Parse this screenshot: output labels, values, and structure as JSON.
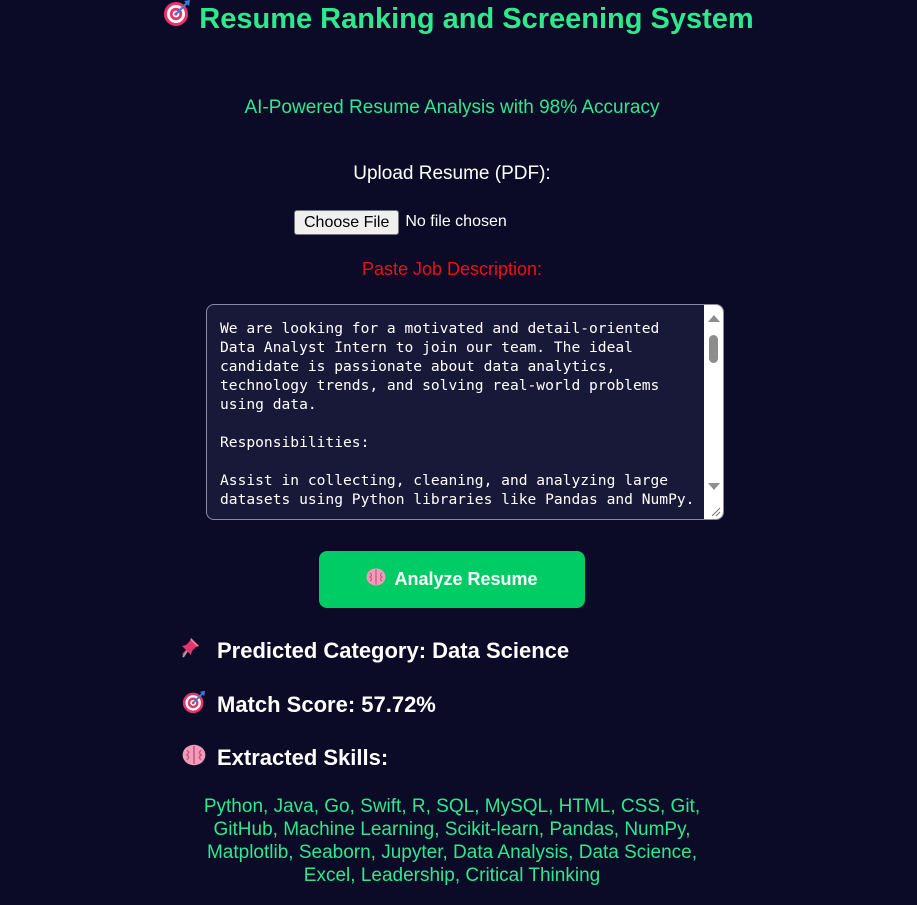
{
  "header": {
    "title": "Resume Ranking and Screening System",
    "title_icon": "direct-hit-target-icon",
    "subtitle": "AI-Powered Resume Analysis with 98% Accuracy"
  },
  "upload": {
    "label": "Upload Resume (PDF):",
    "button_label": "Choose File",
    "status": "No file chosen"
  },
  "job_description": {
    "label": "Paste Job Description:",
    "text": "We are looking for a motivated and detail-oriented Data Analyst Intern to join our team. The ideal candidate is passionate about data analytics, technology trends, and solving real-world problems using data.\n\nResponsibilities:\n\nAssist in collecting, cleaning, and analyzing large datasets using Python libraries like Pandas and NumPy."
  },
  "analyze_button": {
    "label": "Analyze Resume",
    "icon": "brain-icon"
  },
  "results": {
    "category": "Predicted Category: Data Science",
    "category_icon": "pushpin-icon",
    "match_score": "Match Score: 57.72%",
    "match_icon": "direct-hit-target-icon",
    "skills_heading": "Extracted Skills:",
    "skills_icon": "brain-icon",
    "skills": "Python, Java, Go, Swift, R, SQL, MySQL, HTML, CSS, Git, GitHub, Machine Learning, Scikit-learn, Pandas, NumPy, Matplotlib, Seaborn, Jupyter, Data Analysis, Data Science, Excel, Leadership, Critical Thinking"
  },
  "colors": {
    "background": "#0b0b27",
    "accent_green": "#2ee88e",
    "button_green": "#00cc66",
    "label_red": "#ee1111",
    "textarea_bg": "#181838"
  }
}
